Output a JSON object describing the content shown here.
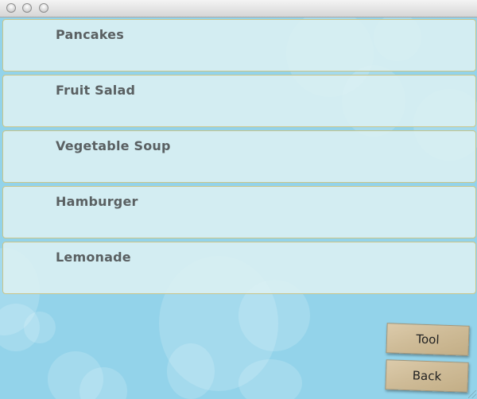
{
  "window": {
    "title": ""
  },
  "menu": {
    "items": [
      {
        "label": "Pancakes"
      },
      {
        "label": "Fruit Salad"
      },
      {
        "label": "Vegetable Soup"
      },
      {
        "label": "Hamburger"
      },
      {
        "label": "Lemonade"
      }
    ]
  },
  "buttons": {
    "tool_label": "Tool",
    "back_label": "Back"
  },
  "colors": {
    "background": "#93d3ea",
    "row_fill": "#dcf0f2",
    "row_border": "#c9c58a",
    "button_fill": "#cfbc98"
  }
}
